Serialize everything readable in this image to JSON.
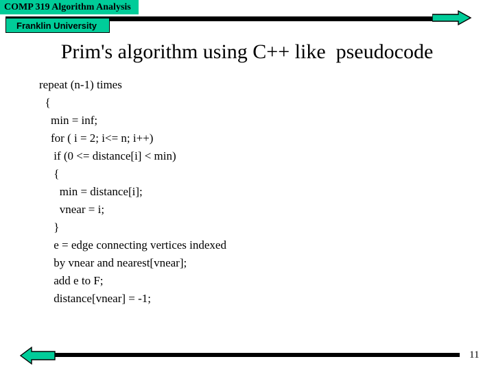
{
  "header": {
    "course_label": "COMP 319  Algorithm Analysis",
    "school_label": "Franklin University",
    "accent_color": "#00CC99",
    "rule_color": "#000000",
    "right_arrow_icon": "arrow-right-icon"
  },
  "title": "Prim's algorithm using C++ like  pseudocode",
  "code": {
    "lines": [
      "repeat (n-1) times",
      "  {",
      "    min = inf;",
      "    for ( i = 2; i<= n; i++)",
      "     if (0 <= distance[i] < min)",
      "     {",
      "       min = distance[i];",
      "       vnear = i;",
      "     }",
      "     e = edge connecting vertices indexed",
      "     by vnear and nearest[vnear];",
      "     add e to F;",
      "     distance[vnear] = -1;"
    ]
  },
  "footer": {
    "page_number": "11",
    "left_arrow_icon": "arrow-left-icon",
    "accent_color": "#00CC99",
    "rule_color": "#000000"
  }
}
